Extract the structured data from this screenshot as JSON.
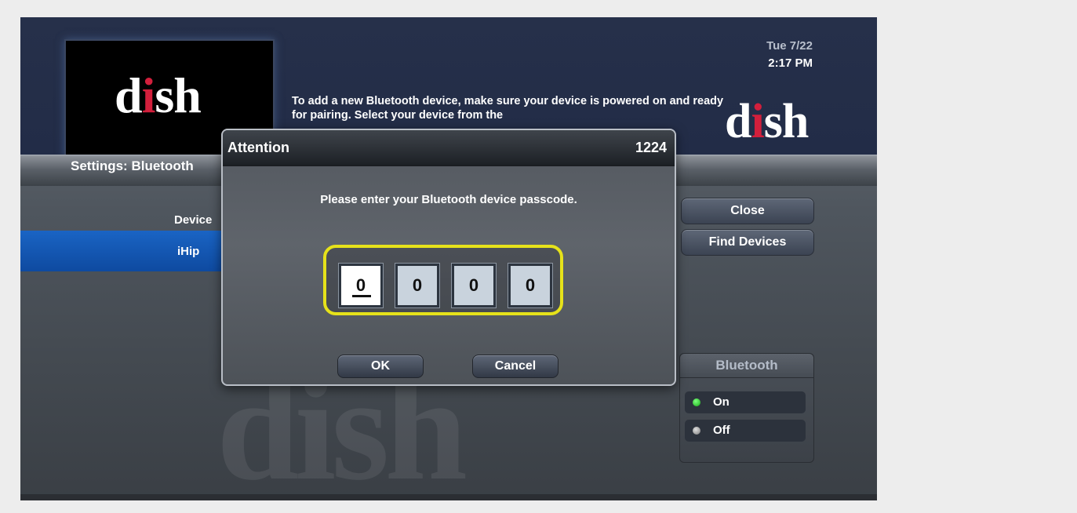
{
  "header": {
    "date": "Tue 7/22",
    "time": "2:17 PM",
    "instructions": "To add a new Bluetooth device, make sure your device is powered on and ready for pairing. Select your device from the",
    "preview_logo": {
      "d": "d",
      "i": "i",
      "sh": "sh"
    },
    "brand_logo": {
      "d": "d",
      "i": "i",
      "sh": "sh"
    }
  },
  "settings": {
    "title": "Settings:  Bluetooth",
    "column_header": "Device",
    "devices": [
      "iHip"
    ]
  },
  "side_buttons": {
    "close": "Close",
    "find_devices": "Find Devices"
  },
  "bluetooth_panel": {
    "title": "Bluetooth",
    "options": [
      {
        "label": "On",
        "status_color": "#22c022"
      },
      {
        "label": "Off",
        "status_color": "#9a9a9a"
      }
    ]
  },
  "dialog": {
    "title": "Attention",
    "code": "1224",
    "message": "Please enter your Bluetooth device passcode.",
    "passcode_digits": [
      "0",
      "0",
      "0",
      "0"
    ],
    "ok_label": "OK",
    "cancel_label": "Cancel"
  },
  "colors": {
    "header_band": "#232d48",
    "highlight_ring": "#e6e21a",
    "selected_row": "#1459b6",
    "logo_dot": "#d21f3c"
  }
}
